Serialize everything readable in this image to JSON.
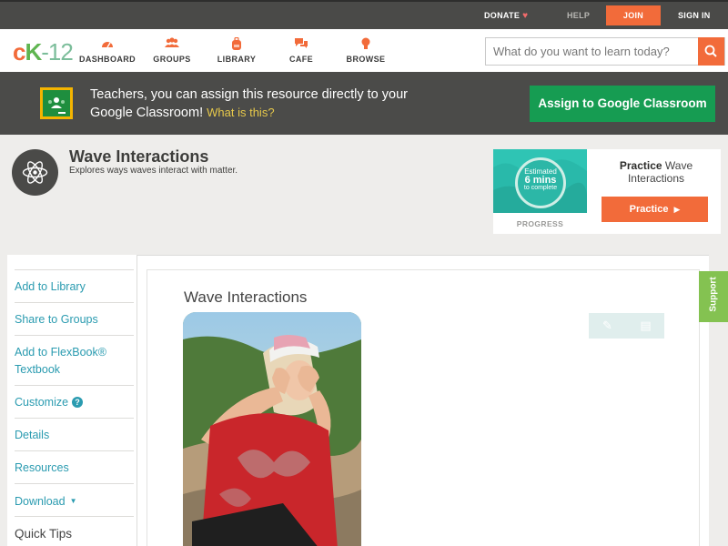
{
  "topbar": {
    "donate": "DONATE",
    "help": "HELP",
    "join": "JOIN",
    "signin": "SIGN IN"
  },
  "logo": {
    "c": "c",
    "k": "K",
    "rest": "-12"
  },
  "nav": {
    "items": [
      {
        "label": "DASHBOARD",
        "icon": "dashboard-gauge-icon"
      },
      {
        "label": "GROUPS",
        "icon": "groups-people-icon"
      },
      {
        "label": "LIBRARY",
        "icon": "library-backpack-icon"
      },
      {
        "label": "CAFE",
        "icon": "cafe-chat-icon"
      },
      {
        "label": "BROWSE",
        "icon": "browse-lightbulb-icon"
      }
    ],
    "search_placeholder": "What do you want to learn today?"
  },
  "banner": {
    "text": "Teachers, you can assign this resource directly to your Google Classroom!",
    "what_link": "What is this?",
    "button": "Assign to Google Classroom"
  },
  "resource": {
    "title": "Wave Interactions",
    "subtitle": "Explores ways waves interact with matter."
  },
  "practice": {
    "estimated": "Estimated",
    "mins": "6 mins",
    "to_complete": "to complete",
    "progress_label": "PROGRESS",
    "heading_bold": "Practice",
    "heading_rest": "Wave Interactions",
    "button": "Practice"
  },
  "sidebar": {
    "items": [
      {
        "label": "Add to Library"
      },
      {
        "label": "Share to Groups"
      },
      {
        "label": "Add to FlexBook® Textbook"
      },
      {
        "label": "Customize"
      },
      {
        "label": "Details"
      },
      {
        "label": "Resources"
      },
      {
        "label": "Download"
      },
      {
        "label": "Quick Tips"
      }
    ]
  },
  "content": {
    "title": "Wave Interactions"
  },
  "support": "Support",
  "colors": {
    "accent": "#f26b3a",
    "teal_link": "#2a9bb0",
    "classroom_green": "#169c52",
    "support_green": "#84c251"
  }
}
